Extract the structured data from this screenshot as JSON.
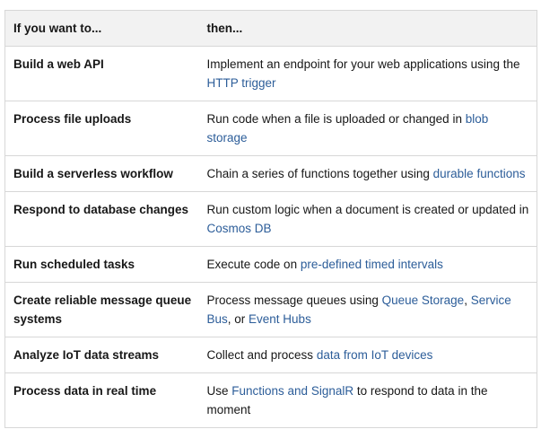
{
  "header": {
    "col1": "If you want to...",
    "col2": "then..."
  },
  "rows": [
    {
      "task": "Build a web API",
      "before": "Implement an endpoint for your web applications using the ",
      "link": "HTTP trigger",
      "after": ""
    },
    {
      "task": "Process file uploads",
      "before": "Run code when a file is uploaded or changed in ",
      "link": "blob storage",
      "after": ""
    },
    {
      "task": "Build a serverless workflow",
      "before": "Chain a series of functions together using ",
      "link": "durable functions",
      "after": ""
    },
    {
      "task": "Respond to database changes",
      "before": "Run custom logic when a document is created or updated in ",
      "link": "Cosmos DB",
      "after": ""
    },
    {
      "task": "Run scheduled tasks",
      "before": "Execute code on ",
      "link": "pre-defined timed intervals",
      "after": ""
    },
    {
      "task": "Create reliable message queue systems",
      "before": "Process message queues using ",
      "link": "Queue Storage",
      "mid1": ", ",
      "link2": "Service Bus",
      "mid2": ", or ",
      "link3": "Event Hubs",
      "after": ""
    },
    {
      "task": "Analyze IoT data streams",
      "before": "Collect and process ",
      "link": "data from IoT devices",
      "after": ""
    },
    {
      "task": "Process data in real time",
      "before": "Use ",
      "link": "Functions and SignalR",
      "after": " to respond to data in the moment"
    }
  ]
}
